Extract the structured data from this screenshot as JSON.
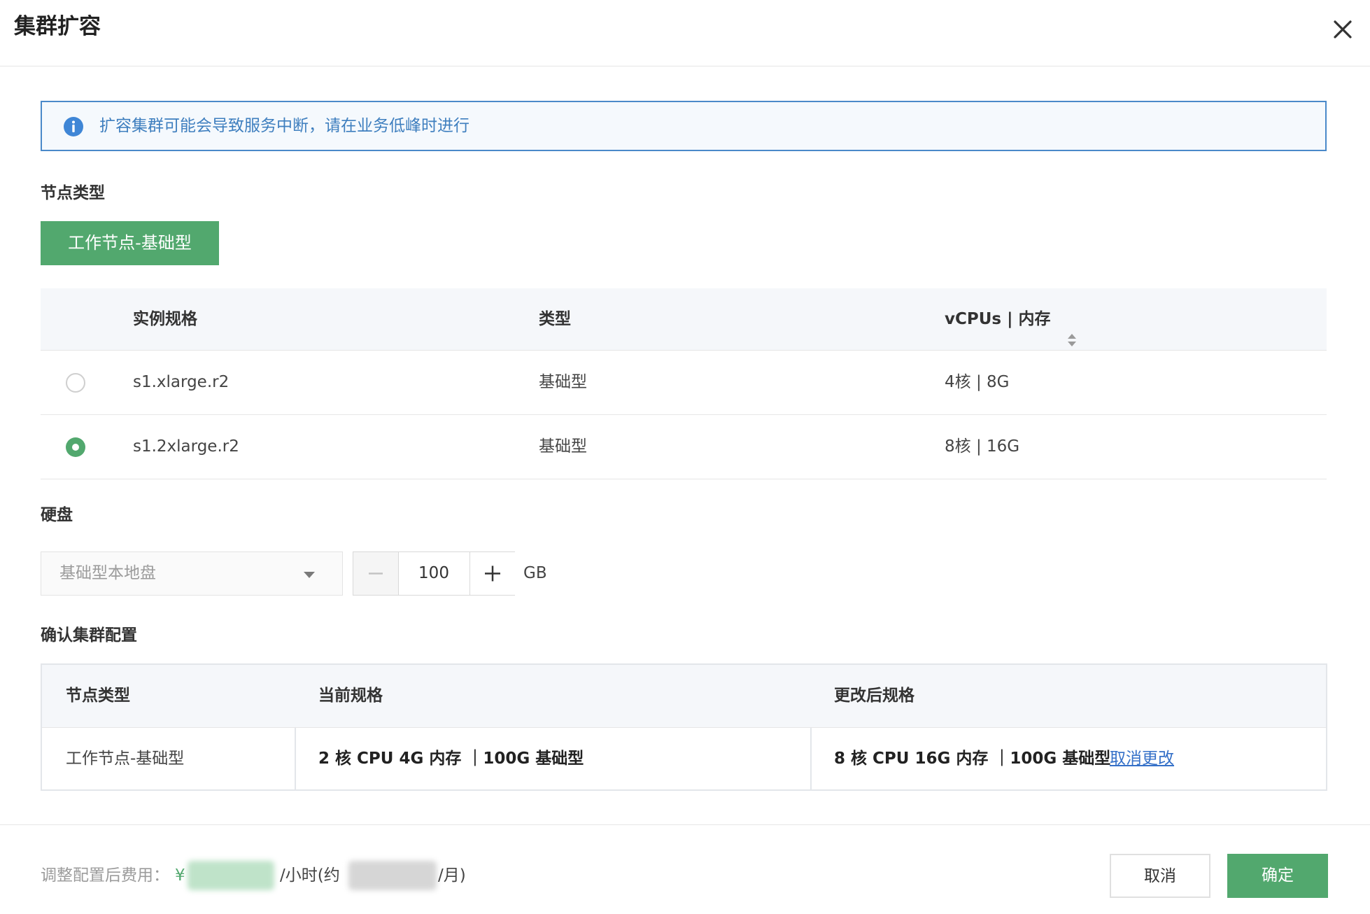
{
  "dialog": {
    "title": "集群扩容"
  },
  "alert": {
    "text": "扩容集群可能会导致服务中断，请在业务低峰时进行"
  },
  "node_type": {
    "label": "节点类型",
    "selected": "工作节点-基础型"
  },
  "spec_table": {
    "columns": [
      "实例规格",
      "类型",
      "vCPUs | 内存"
    ],
    "rows": [
      {
        "spec": "s1.xlarge.r2",
        "type": "基础型",
        "vcpu_mem": "4核 | 8G",
        "selected": false
      },
      {
        "spec": "s1.2xlarge.r2",
        "type": "基础型",
        "vcpu_mem": "8核 | 16G",
        "selected": true
      }
    ]
  },
  "disk": {
    "label": "硬盘",
    "select_value": "基础型本地盘",
    "size": "100",
    "unit": "GB"
  },
  "confirm": {
    "label": "确认集群配置",
    "columns": [
      "节点类型",
      "当前规格",
      "更改后规格"
    ],
    "row": {
      "node_type": "工作节点-基础型",
      "current": "2 核 CPU 4G 内存 ｜100G 基础型",
      "changed": "8 核 CPU 16G 内存 ｜100G 基础型",
      "cancel_link": "取消更改"
    }
  },
  "footer": {
    "price_label": "调整配置后费用：",
    "currency": "¥",
    "per_hour": "/小时(约",
    "per_month": "/月)",
    "cancel_button": "取消",
    "confirm_button": "确定"
  },
  "colors": {
    "primary_green": "#52a86e",
    "info_blue": "#4a89c9",
    "link_blue": "#3470c8"
  }
}
